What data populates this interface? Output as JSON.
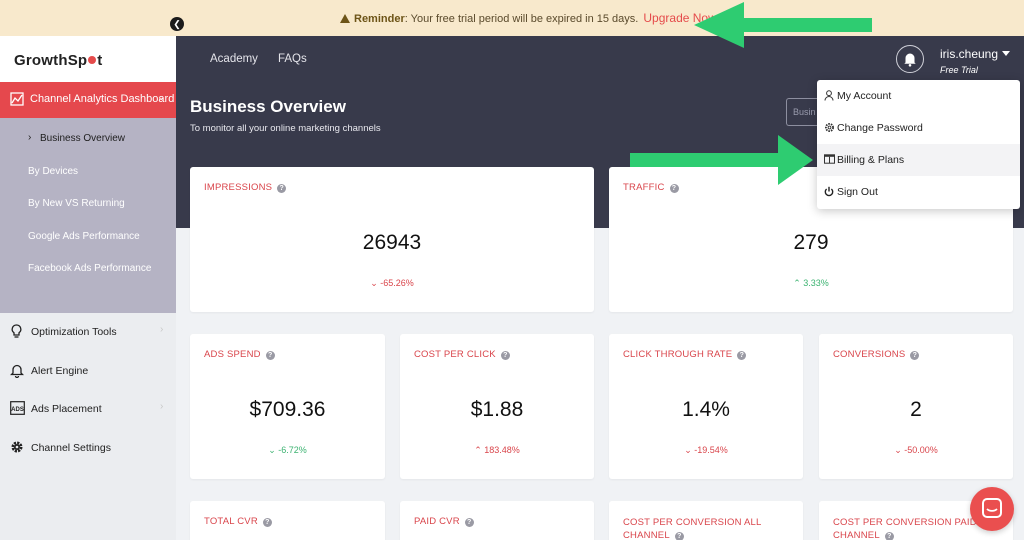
{
  "banner": {
    "reminder_label": "Reminder",
    "message": ": Your free trial period will be expired in 15 days.",
    "upgrade_link": "Upgrade Now"
  },
  "brand": {
    "logo_left": "GrowthSp",
    "logo_right": "t"
  },
  "sidebar": {
    "active_item": "Channel Analytics Dashboard",
    "subitems": [
      "Business Overview",
      "By Devices",
      "By New VS Returning",
      "Google Ads Performance",
      "Facebook Ads Performance"
    ],
    "items": [
      {
        "label": "Optimization Tools",
        "icon": "lightbulb-icon"
      },
      {
        "label": "Alert Engine",
        "icon": "bell-icon"
      },
      {
        "label": "Ads Placement",
        "icon": "ads-icon"
      },
      {
        "label": "Channel Settings",
        "icon": "gear-icon"
      }
    ]
  },
  "topbar": {
    "nav": [
      "Academy",
      "FAQs"
    ],
    "user_name": "iris.cheung",
    "user_plan": "Free Trial"
  },
  "hero": {
    "title": "Business Overview",
    "subtitle": "To monitor all your online marketing channels",
    "input_placeholder": "Busin"
  },
  "dropdown": {
    "items": [
      {
        "label": "My Account",
        "icon": "user-icon"
      },
      {
        "label": "Change Password",
        "icon": "gear-icon"
      },
      {
        "label": "Billing & Plans",
        "icon": "billing-icon"
      },
      {
        "label": "Sign Out",
        "icon": "power-icon"
      }
    ]
  },
  "metrics": {
    "impressions": {
      "title": "IMPRESSIONS",
      "value": "26943",
      "change": "-65.26%",
      "direction": "down"
    },
    "traffic": {
      "title": "TRAFFIC",
      "value": "279",
      "change": "3.33%",
      "direction": "up"
    },
    "ads_spend": {
      "title": "ADS SPEND",
      "value": "$709.36",
      "change": "-6.72%",
      "direction": "down"
    },
    "cost_per_click": {
      "title": "COST PER CLICK",
      "value": "$1.88",
      "change": "183.48%",
      "direction": "up"
    },
    "ctr": {
      "title": "CLICK THROUGH RATE",
      "value": "1.4%",
      "change": "-19.54%",
      "direction": "down"
    },
    "conversions": {
      "title": "CONVERSIONS",
      "value": "2",
      "change": "-50.00%",
      "direction": "down"
    },
    "total_cvr": {
      "title": "TOTAL CVR"
    },
    "paid_cvr": {
      "title": "PAID CVR"
    },
    "cpc_all": {
      "title_line1": "COST PER CONVERSION ALL",
      "title_line2": "CHANNEL"
    },
    "cpc_paid": {
      "title_line1": "COST PER CONVERSION PAID",
      "title_line2": "CHANNEL"
    }
  },
  "colors": {
    "accent": "#e5484d",
    "dark": "#383a4b",
    "up": "#3cb371",
    "arrow": "#2ecc71"
  }
}
